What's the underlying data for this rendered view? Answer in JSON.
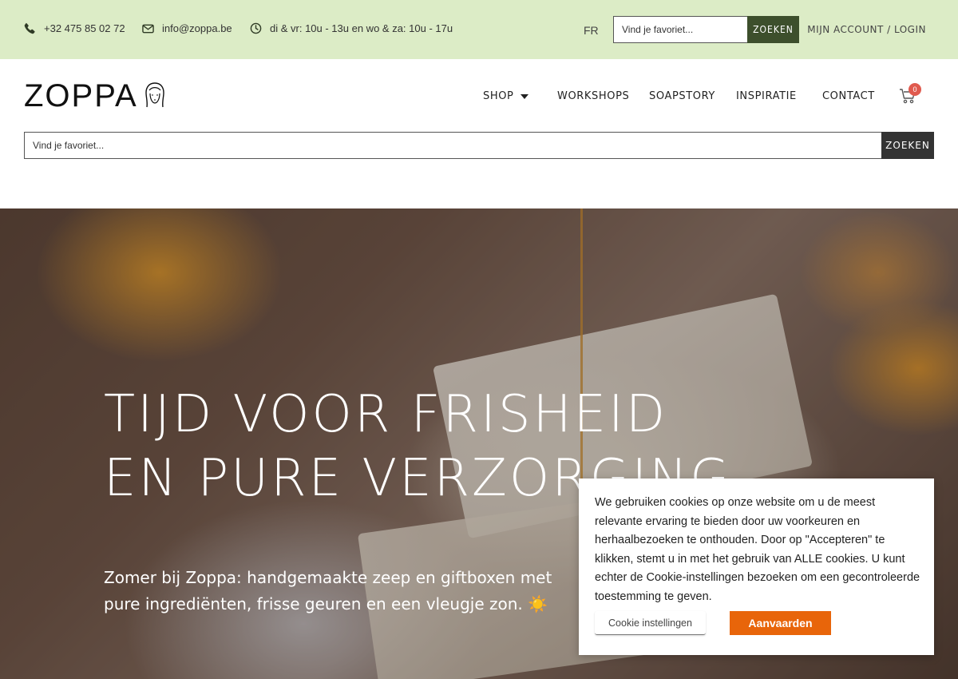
{
  "topbar": {
    "phone": "+32 475 85 02 72",
    "email": "info@zoppa.be",
    "hours": "di & vr: 10u - 13u en wo & za: 10u - 17u",
    "language": "FR",
    "search_placeholder": "Vind je favoriet...",
    "search_button": "ZOEKEN",
    "account": "MIJN ACCOUNT / LOGIN",
    "background_color": "#dcecc6",
    "search_button_color": "#3d4f2c"
  },
  "header": {
    "logo_text": "ZOPPA",
    "nav": [
      {
        "label": "SHOP"
      },
      {
        "label": "WORKSHOPS"
      },
      {
        "label": "SOAPSTORY"
      },
      {
        "label": "INSPIRATIE"
      },
      {
        "label": "CONTACT"
      }
    ],
    "cart_count": "0",
    "search_placeholder": "Vind je favoriet...",
    "search_button": "ZOEKEN"
  },
  "hero": {
    "title_line1": "TIJD VOOR FRISHEID",
    "title_line2": "EN PURE VERZORGING",
    "subtitle": "Zomer bij Zoppa: handgemaakte zeep en giftboxen met pure ingrediënten, frisse geuren en een vleugje zon. ☀️"
  },
  "cookie": {
    "text": "We gebruiken cookies op onze website om u de meest relevante ervaring te bieden door uw voorkeuren en herhaalbezoeken te onthouden. Door op \"Accepteren\" te klikken, stemt u in met het gebruik van ALLE cookies. U kunt echter de Cookie-instellingen bezoeken om een gecontroleerde toestemming te geven.",
    "settings_button": "Cookie instellingen",
    "accept_button": "Aanvaarden",
    "accept_color": "#e8650a"
  },
  "icons": [
    "phone-icon",
    "envelope-icon",
    "clock-icon",
    "caret-down-icon",
    "cart-icon",
    "logo-face-icon"
  ]
}
